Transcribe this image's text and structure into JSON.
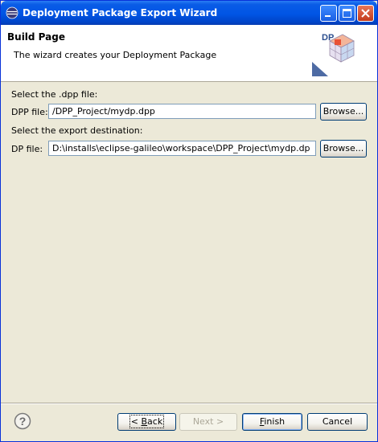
{
  "window": {
    "title": "Deployment Package Export Wizard"
  },
  "header": {
    "title": "Build Page",
    "description": "The wizard creates your Deployment Package",
    "logo_text": "DP"
  },
  "form": {
    "dpp_section_label": "Select the .dpp file:",
    "dpp_field_label": "DPP file:",
    "dpp_field_value": "/DPP_Project/mydp.dpp",
    "export_section_label": "Select the export destination:",
    "dp_field_label": "DP file:",
    "dp_field_value": "D:\\installs\\eclipse-galileo\\workspace\\DPP_Project\\mydp.dp",
    "browse_label": "Browse..."
  },
  "footer": {
    "back_prefix": "< ",
    "back_mnemonic": "B",
    "back_rest": "ack",
    "next_label": "Next >",
    "finish_mnemonic": "F",
    "finish_rest": "inish",
    "cancel_label": "Cancel"
  },
  "colors": {
    "titlebar": "#0055e5",
    "dialog_bg": "#ece9d8",
    "field_border": "#7f9db9",
    "button_border": "#003c74"
  }
}
